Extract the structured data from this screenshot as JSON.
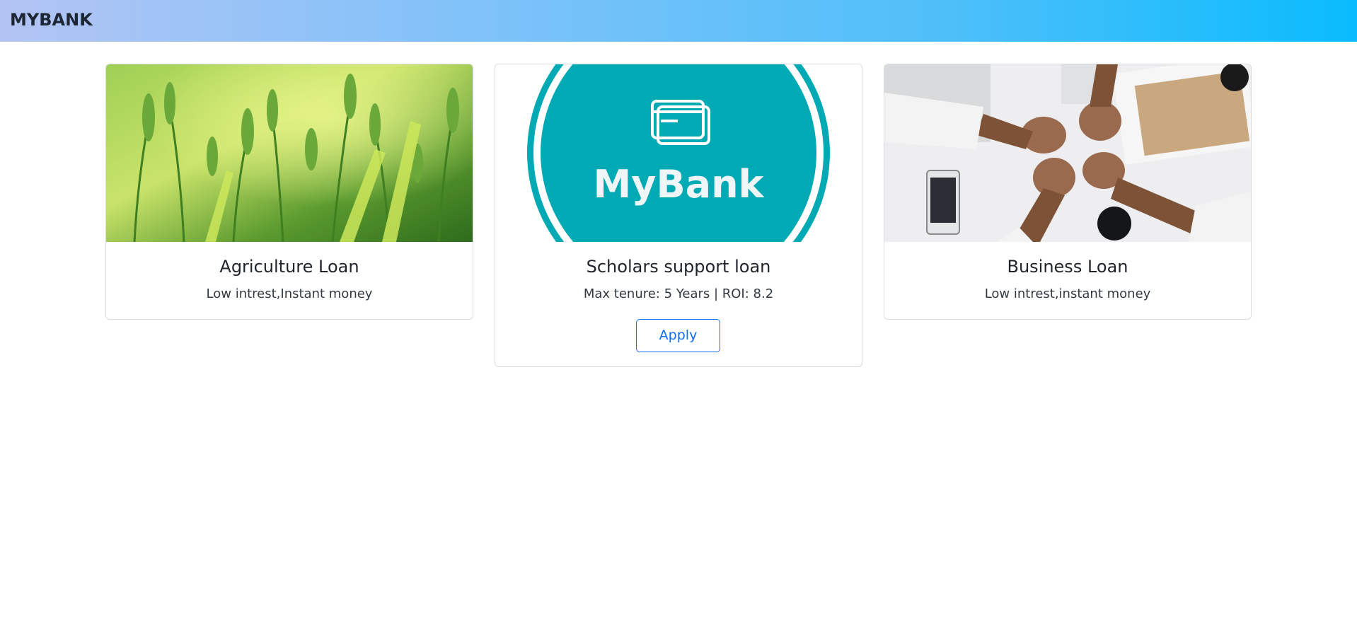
{
  "navbar": {
    "brand": "MYBANK"
  },
  "cards": [
    {
      "title": "Agriculture Loan",
      "text": "Low intrest,Instant money",
      "image": "wheat-field-image"
    },
    {
      "title": "Scholars support loan",
      "text": "Max tenure: 5 Years | ROI: 8.2",
      "button_label": "Apply",
      "image": "mybank-logo-image",
      "logo_text": "MyBank"
    },
    {
      "title": "Business Loan",
      "text": "Low intrest,instant money",
      "image": "team-fist-bump-image"
    }
  ],
  "colors": {
    "navbar_gradient_start": "#b3c4f4",
    "navbar_gradient_end": "#09bcfd",
    "logo_teal": "#00aab5",
    "button_blue": "#0d6efd",
    "card_border": "#d9dcdf"
  },
  "icons": {
    "logo_icon": "credit-card-icon"
  }
}
